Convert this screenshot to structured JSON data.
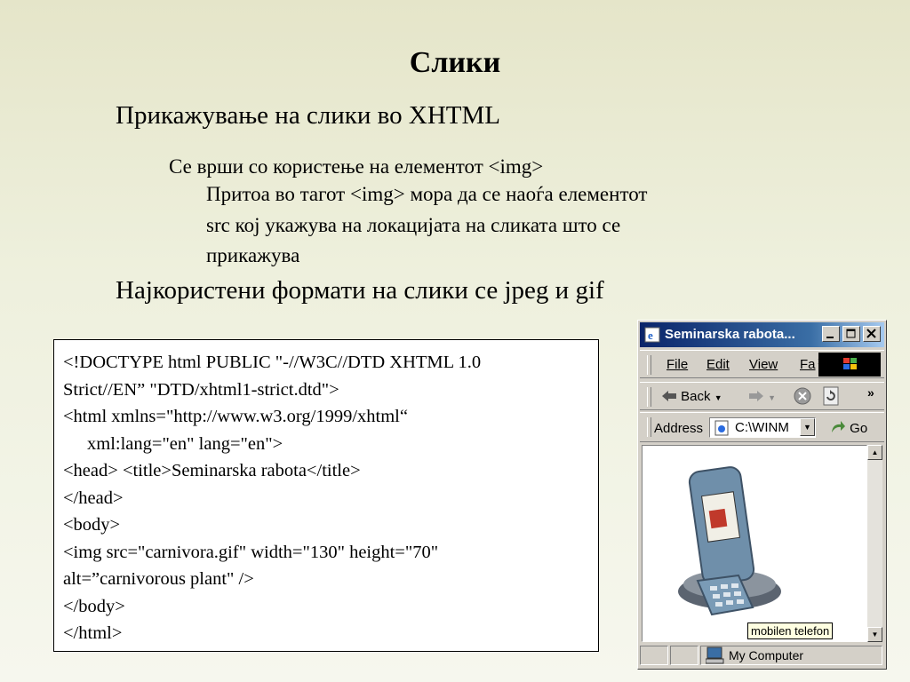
{
  "slide": {
    "title": "Слики",
    "bullet1": "Прикажување на слики во XHTML",
    "bullet2": "Се врши со користење на елементот <img>",
    "bullet3_lines": [
      "Притоа во тагот <img> мора да се наоѓа елементот",
      "src кој укажува на локацијата на сликата што се",
      "прикажува"
    ],
    "bullet4": "Најкористени формати на слики се jpeg и gif"
  },
  "code": {
    "lines": [
      "<!DOCTYPE html PUBLIC \"-//W3C//DTD XHTML 1.0",
      "Strict//EN” \"DTD/xhtml1-strict.dtd\">",
      "<html xmlns=\"http://www.w3.org/1999/xhtml“",
      "xml:lang=\"en\" lang=\"en\">",
      "<head> <title>Seminarska rabota</title>",
      "</head>",
      "<body>",
      "<img src=\"carnivora.gif\" width=\"130\" height=\"70\"",
      "alt=”carnivorous plant\" />",
      "</body>",
      "</html>"
    ]
  },
  "browser": {
    "window_title": "Seminarska rabota...",
    "menu": {
      "file": "File",
      "edit": "Edit",
      "view": "View",
      "favorites": "Fa"
    },
    "nav": {
      "back": "Back"
    },
    "address_label": "Address",
    "address_value": "C:\\WINM",
    "go_label": "Go",
    "tooltip": "mobilen telefon",
    "status_zone": "My Computer",
    "colors": {
      "titlebar": "#0a246a",
      "chrome": "#d4d0c8",
      "tooltip_bg": "#ffffe1"
    }
  }
}
